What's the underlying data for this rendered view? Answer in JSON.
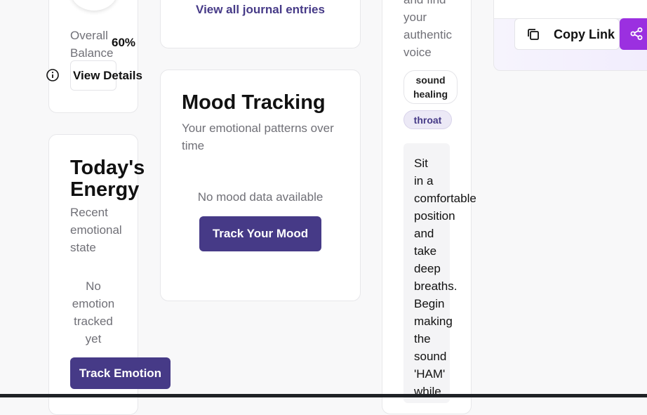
{
  "balance": {
    "label_line1": "Overall",
    "label_line2": "Balance",
    "percent": "60%",
    "details_button": "View Details",
    "info_icon": "info-circle-icon"
  },
  "energy": {
    "title_line1": "Today's",
    "title_line2": "Energy",
    "subtitle_line1": "Recent",
    "subtitle_line2": "emotional",
    "subtitle_line3": "state",
    "empty_line1": "No",
    "empty_line2": "emotion",
    "empty_line3": "tracked",
    "empty_line4": "yet",
    "track_button": "Track Emotion"
  },
  "journal": {
    "view_all_link": "View all journal entries"
  },
  "mood": {
    "title": "Mood Tracking",
    "subtitle_line1": "Your emotional patterns over",
    "subtitle_line2": "time",
    "empty": "No mood data available",
    "track_button": "Track Your Mood"
  },
  "practice": {
    "desc_line1": "and find",
    "desc_line2": "your",
    "desc_line3": "authentic",
    "desc_line4": "voice",
    "tag1_line1": "sound",
    "tag1_line2": "healing",
    "tag2": "throat",
    "instructions": [
      "Sit",
      "in a",
      "comfortable",
      "position",
      "and",
      "take",
      "deep",
      "breaths.",
      "Begin",
      "making",
      "the",
      "sound",
      "'HAM'",
      "while"
    ]
  },
  "share": {
    "copy_link_label": "Copy Link",
    "copy_icon": "copy-icon",
    "share_icon": "share-icon"
  },
  "colors": {
    "primary": "#463a87",
    "share": "#9b30e0",
    "tag_bg": "#ece9f6"
  }
}
